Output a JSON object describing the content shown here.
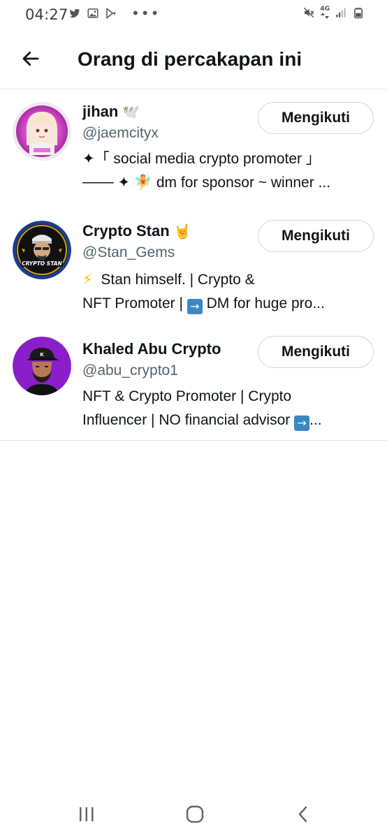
{
  "status_bar": {
    "time": "04:27",
    "overflow_dots": "•••",
    "network_label": "4G",
    "left_icons": [
      "twitter-icon",
      "image-icon",
      "play-store-icon"
    ],
    "right_icons": [
      "mute-icon",
      "signal-icon",
      "battery-icon"
    ]
  },
  "header": {
    "title": "Orang di percakapan ini",
    "back_icon": "back-arrow-icon"
  },
  "people": [
    {
      "name": "jihan",
      "name_emoji": "🕊️",
      "handle": "@jaemcityx",
      "bio_line1": "✦「 social media crypto promoter 」",
      "bio_line2": "─── ✦ 🧚 dm for sponsor ~ winner ...",
      "follow_label": "Mengikuti",
      "avatar_desc": "pink-cartoon-avatar"
    },
    {
      "name": "Crypto Stan",
      "name_emoji": "🤘",
      "handle": "@Stan_Gems",
      "bio_line1": "Stan himself. | Crypto &",
      "bio_line1_prefix": "⚡",
      "bio_line2": "NFT Promoter | ",
      "bio_line2_arrow": "→",
      "bio_line2_rest": " DM for huge pro...",
      "follow_label": "Mengikuti",
      "avatar_text": "CRYPTO STAN"
    },
    {
      "name": "Khaled Abu Crypto",
      "handle": "@abu_crypto1",
      "bio_line1": "NFT & Crypto Promoter | Crypto",
      "bio_line2": "Influencer | NO financial advisor ",
      "bio_line2_arrow": "→",
      "bio_line2_rest": "...",
      "follow_label": "Mengikuti",
      "avatar_desc": "purple-cartoon-avatar"
    }
  ],
  "nav_bar": {
    "recent_icon": "recent-apps-icon",
    "home_icon": "home-icon",
    "back_icon": "back-icon"
  },
  "colors": {
    "text": "#0f1419",
    "secondary": "#536471",
    "border": "#cfd9de",
    "divider": "#e1e5e8",
    "avatar3_bg": "#8a1fc9"
  }
}
